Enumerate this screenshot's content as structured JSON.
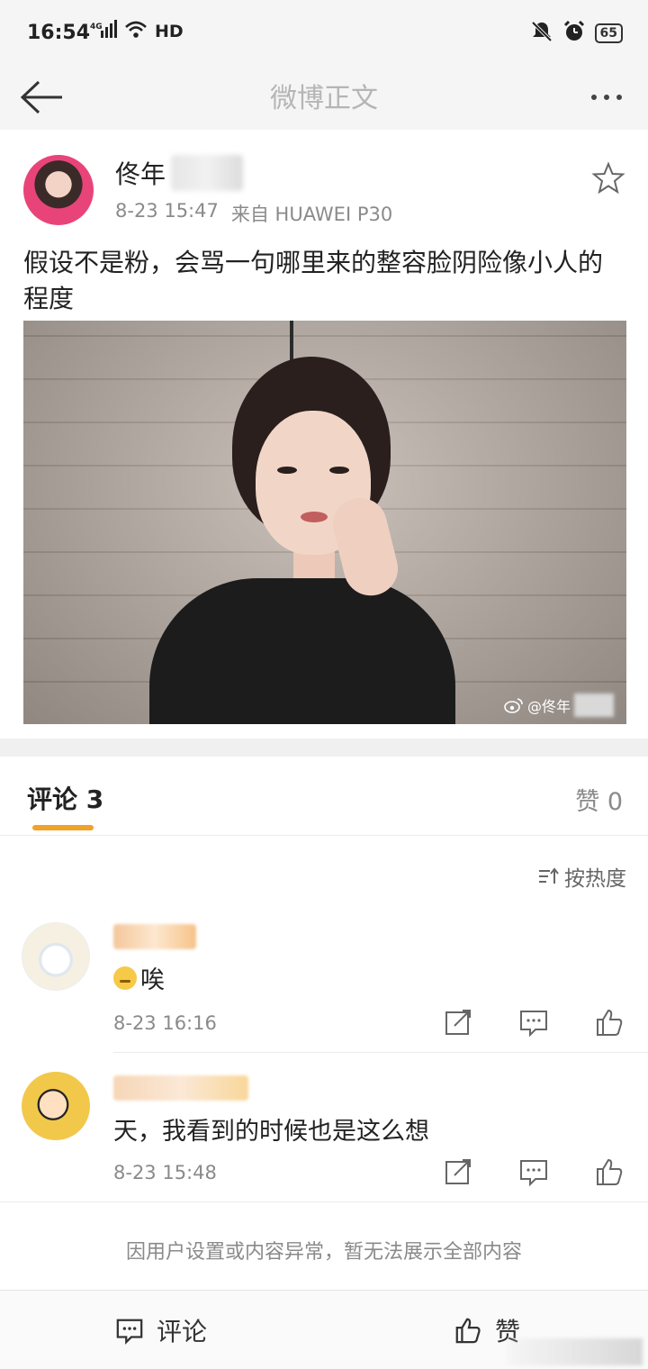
{
  "status_bar": {
    "time": "16:54",
    "network": "4G",
    "hd": "HD",
    "battery": "65"
  },
  "title_bar": {
    "title": "微博正文"
  },
  "post": {
    "author": "佟年",
    "date": "8-23 15:47",
    "source": "来自 HUAWEI P30",
    "text": "假设不是粉，会骂一句哪里来的整容脸阴险像小人的程度",
    "image_watermark": "@佟年"
  },
  "tabs": {
    "comments_label": "评论 3",
    "likes_label": "赞 0"
  },
  "sort": {
    "label": "按热度"
  },
  "comments": [
    {
      "text": "唉",
      "time": "8-23 16:16"
    },
    {
      "text": "天，我看到的时候也是这么想",
      "time": "8-23 15:48"
    }
  ],
  "notice": "因用户设置或内容异常，暂无法展示全部内容",
  "bottom_bar": {
    "comment_label": "评论",
    "like_label": "赞"
  },
  "colors": {
    "accent": "#f1a229",
    "background": "#f5f5f5"
  }
}
